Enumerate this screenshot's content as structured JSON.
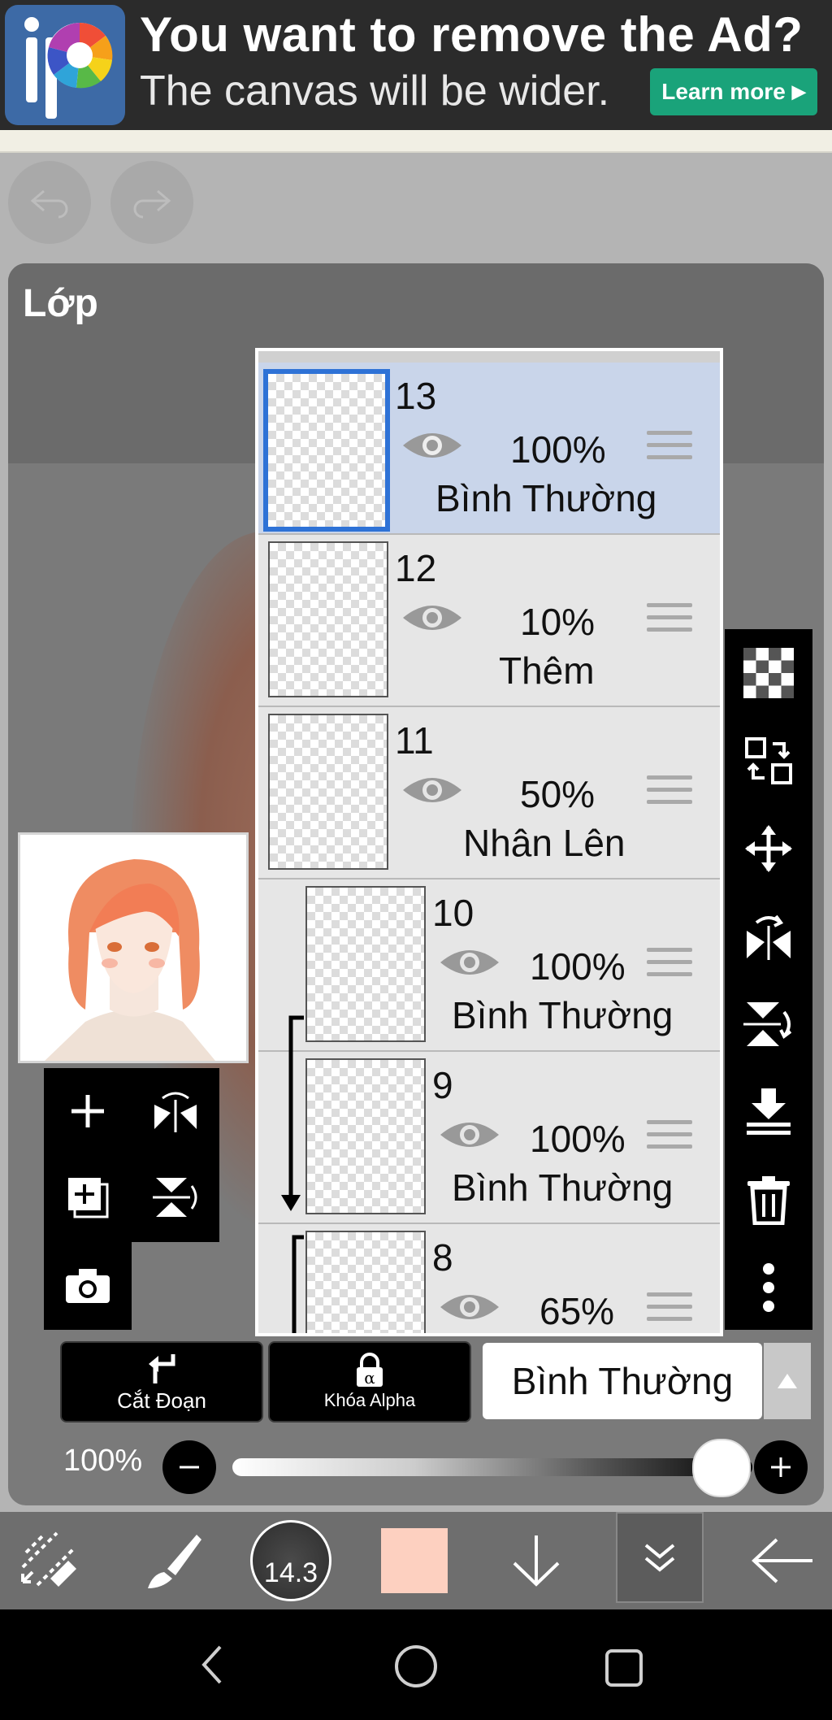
{
  "ad": {
    "headline": "You want to remove the Ad?",
    "subline": "The canvas will be wider.",
    "button_label": "Learn more"
  },
  "panel": {
    "title": "Lớp"
  },
  "layers": [
    {
      "number": "13",
      "opacity": "100%",
      "blend": "Bình Thường",
      "selected": true
    },
    {
      "number": "12",
      "opacity": "10%",
      "blend": "Thêm",
      "selected": false
    },
    {
      "number": "11",
      "opacity": "50%",
      "blend": "Nhân Lên",
      "selected": false
    },
    {
      "number": "10",
      "opacity": "100%",
      "blend": "Bình Thường",
      "selected": false,
      "clipped": true
    },
    {
      "number": "9",
      "opacity": "100%",
      "blend": "Bình Thường",
      "selected": false,
      "clipped": true
    },
    {
      "number": "8",
      "opacity": "65%",
      "blend": "",
      "selected": false,
      "clipped": true
    }
  ],
  "controls": {
    "clip_label": "Cắt Đoạn",
    "alpha_lock_label": "Khóa Alpha",
    "blend_mode": "Bình Thường",
    "opacity_label": "100%",
    "opacity_value": 1.0
  },
  "toolbar": {
    "brush_size": "14.3",
    "current_color": "#fdd0c0"
  },
  "colors": {
    "ad_button": "#1aa37a",
    "selection_blue": "#2e72d6",
    "selected_row": "#c9d5ea"
  },
  "icons": [
    "undo-icon",
    "redo-icon",
    "add-layer-icon",
    "flip-horizontal-icon",
    "duplicate-layer-icon",
    "flip-vertical-icon",
    "camera-icon",
    "checker-icon",
    "transform-icon",
    "move-icon",
    "rotate-flip-icon",
    "merge-down-icon",
    "trash-icon",
    "more-icon",
    "eye-icon",
    "drag-handle-icon",
    "lock-icon",
    "clip-icon"
  ]
}
